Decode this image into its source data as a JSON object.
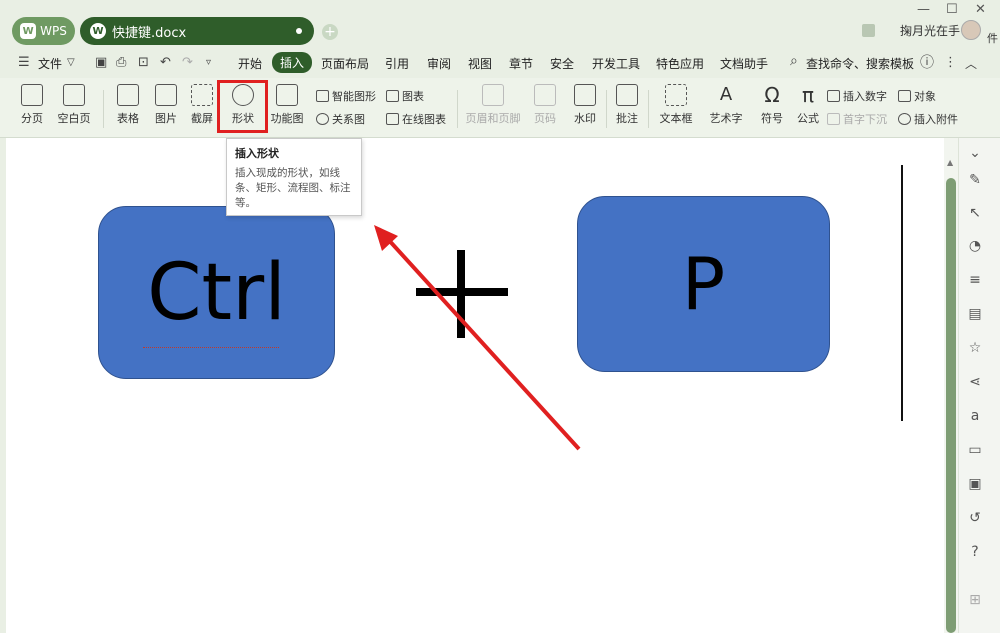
{
  "titlebar": {
    "wps_tab": "WPS",
    "doc_tab": "快捷键.docx",
    "user_name": "掬月光在手",
    "edge_text": "件",
    "window_controls": [
      "—",
      "☐",
      "✕"
    ]
  },
  "menubar": {
    "file": "文件",
    "items": [
      "开始",
      "插入",
      "页面布局",
      "引用",
      "审阅",
      "视图",
      "章节",
      "安全",
      "开发工具",
      "特色应用",
      "文档助手"
    ],
    "active": "插入",
    "search": "查找命令、搜索模板"
  },
  "ribbon": {
    "tools": [
      "分页",
      "空白页",
      "表格",
      "图片",
      "截屏",
      "形状",
      "功能图",
      "页眉和页脚",
      "页码",
      "水印",
      "批注",
      "文本框",
      "艺术字",
      "符号",
      "公式"
    ],
    "small_tools": [
      "智能图形",
      "图表",
      "关系图",
      "在线图表",
      "插入数字",
      "对象",
      "首字下沉",
      "插入附件"
    ]
  },
  "tooltip": {
    "title": "插入形状",
    "body": "插入现成的形状，如线条、矩形、流程图、标注等。"
  },
  "document": {
    "key_left": "Ctrl",
    "key_right": "P"
  },
  "colors": {
    "accent": "#2f5d2a",
    "key_fill": "#4472c4",
    "highlight": "#e02020"
  }
}
